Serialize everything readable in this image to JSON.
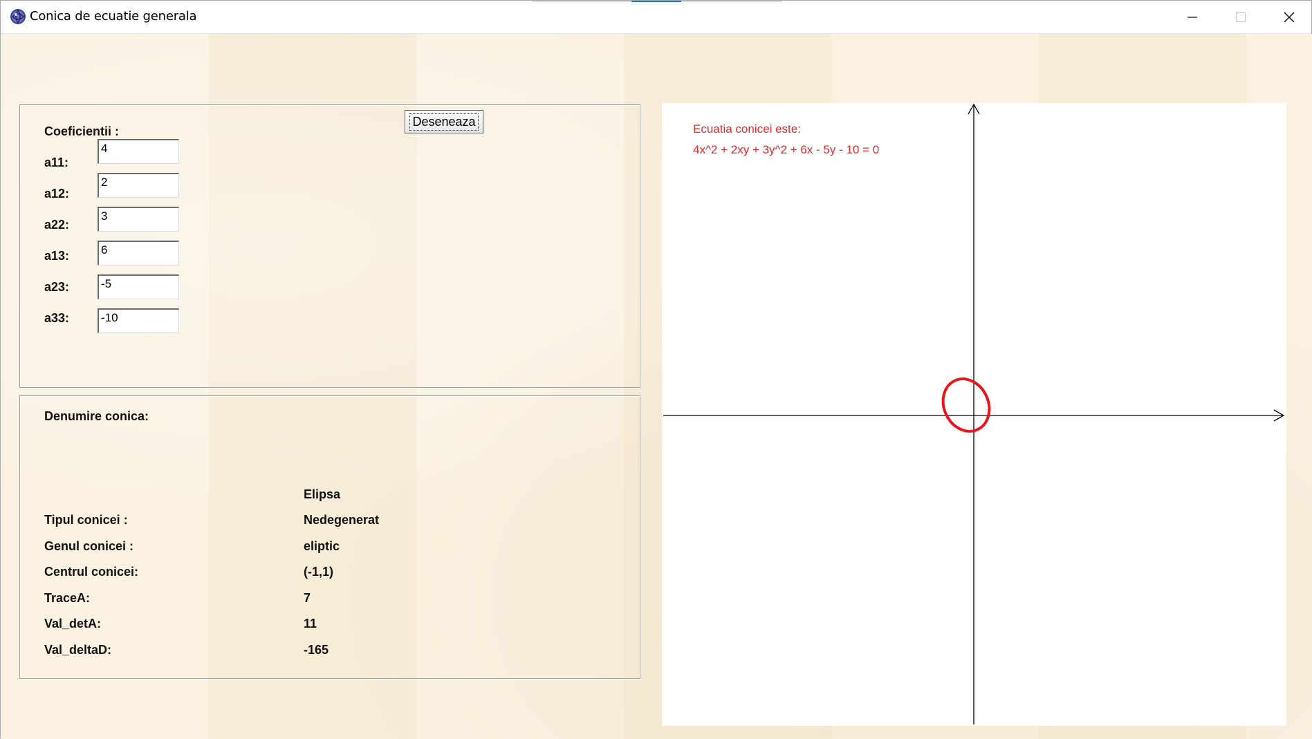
{
  "window": {
    "title": "Conica de ecuatie generala",
    "icon": "app-globe-icon",
    "controls": [
      "minimize-icon",
      "maximize-icon",
      "close-icon"
    ]
  },
  "coefficients": {
    "heading": "Coeficientii :",
    "fields": [
      {
        "label": "a11:",
        "value": "4"
      },
      {
        "label": "a12:",
        "value": "2"
      },
      {
        "label": "a22:",
        "value": "3"
      },
      {
        "label": "a13:",
        "value": "6"
      },
      {
        "label": "a23:",
        "value": "-5"
      },
      {
        "label": "a33:",
        "value": "-10"
      }
    ],
    "draw_button": "Deseneaza"
  },
  "info": {
    "name_label": "Denumire conica:",
    "name_value": "Elipsa",
    "rows": [
      {
        "label": "Tipul conicei :",
        "value": "Nedegenerat"
      },
      {
        "label": "Genul conicei :",
        "value": "eliptic"
      },
      {
        "label": "Centrul conicei:",
        "value": "(-1,1)"
      },
      {
        "label": "TraceA:",
        "value": "7"
      },
      {
        "label": "Val_detA:",
        "value": "11"
      },
      {
        "label": "Val_deltaD:",
        "value": "-165"
      }
    ]
  },
  "plot": {
    "equation_title": "Ecuatia conicei este:",
    "equation": "4x^2 + 2xy + 3y^2 + 6x - 5y - 10 = 0",
    "curve_color": "#e8151b",
    "axis_color": "#000000",
    "text_color": "#e5262a"
  }
}
